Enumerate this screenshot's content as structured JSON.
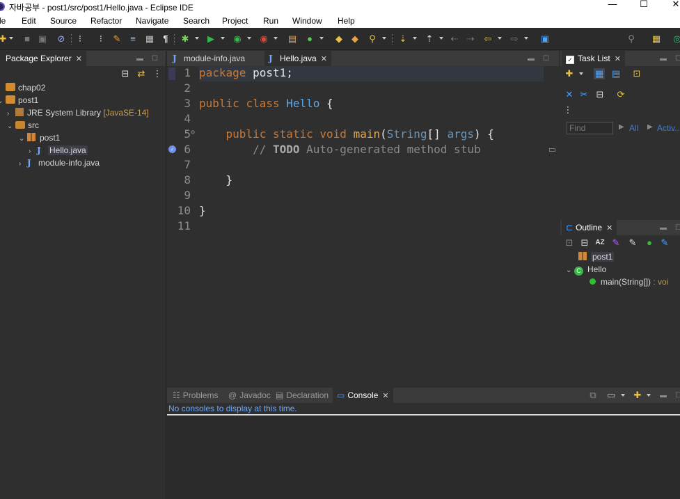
{
  "window": {
    "title": "자바공부 - post1/src/post1/Hello.java - Eclipse IDE",
    "minimize": "—",
    "maximize": "☐",
    "close": "✕"
  },
  "menu": [
    "le",
    "Edit",
    "Source",
    "Refactor",
    "Navigate",
    "Search",
    "Project",
    "Run",
    "Window",
    "Help"
  ],
  "package_explorer": {
    "tab_label": "Package Explorer",
    "tree": [
      {
        "label": "chap02",
        "kind": "project",
        "expanded": false
      },
      {
        "label": "post1",
        "kind": "project",
        "expanded": true
      },
      {
        "label": "JRE System Library",
        "decoration": "[JavaSE-14]",
        "kind": "library",
        "expanded": false
      },
      {
        "label": "src",
        "kind": "folder",
        "expanded": true
      },
      {
        "label": "post1",
        "kind": "package",
        "expanded": true
      },
      {
        "label": "Hello.java",
        "kind": "java-file",
        "selected": true
      },
      {
        "label": "module-info.java",
        "kind": "java-file"
      }
    ]
  },
  "editor": {
    "tabs": [
      {
        "label": "module-info.java",
        "active": false
      },
      {
        "label": "Hello.java",
        "active": true
      }
    ],
    "line_numbers": [
      "1",
      "2",
      "3",
      "4",
      "5",
      "6",
      "7",
      "8",
      "9",
      "10",
      "11"
    ],
    "lines": [
      {
        "parts": [
          [
            "kw",
            "package"
          ],
          [
            "txt",
            " post1;"
          ]
        ]
      },
      {
        "parts": []
      },
      {
        "parts": [
          [
            "kw",
            "public"
          ],
          [
            "txt",
            " "
          ],
          [
            "kw",
            "class"
          ],
          [
            "txt",
            " "
          ],
          [
            "cls",
            "Hello"
          ],
          [
            "txt",
            " {"
          ]
        ]
      },
      {
        "parts": []
      },
      {
        "parts": [
          [
            "txt",
            "    "
          ],
          [
            "kw",
            "public"
          ],
          [
            "txt",
            " "
          ],
          [
            "kw",
            "static"
          ],
          [
            "txt",
            " "
          ],
          [
            "kw",
            "void"
          ],
          [
            "txt",
            " "
          ],
          [
            "meth",
            "main"
          ],
          [
            "txt",
            "("
          ],
          [
            "typ",
            "String"
          ],
          [
            "txt",
            "[] "
          ],
          [
            "typ",
            "args"
          ],
          [
            "txt",
            ") {"
          ]
        ]
      },
      {
        "parts": [
          [
            "txt",
            "        "
          ],
          [
            "cmt",
            "// "
          ],
          [
            "todo",
            "TODO"
          ],
          [
            "cmt",
            " Auto-generated method stub"
          ]
        ]
      },
      {
        "parts": []
      },
      {
        "parts": [
          [
            "txt",
            "    }"
          ]
        ]
      },
      {
        "parts": []
      },
      {
        "parts": [
          [
            "txt",
            "}"
          ]
        ]
      },
      {
        "parts": []
      }
    ]
  },
  "task_list": {
    "tab_label": "Task List",
    "find_placeholder": "Find",
    "all_label": "All",
    "activate_label": "Activ..."
  },
  "outline": {
    "tab_label": "Outline",
    "items": [
      {
        "label": "post1",
        "kind": "package"
      },
      {
        "label": "Hello",
        "kind": "class"
      },
      {
        "label": "main(String[])",
        "suffix": ": voi",
        "kind": "method"
      }
    ]
  },
  "bottom": {
    "tabs": [
      {
        "label": "Problems",
        "active": false
      },
      {
        "label": "Javadoc",
        "active": false
      },
      {
        "label": "Declaration",
        "active": false
      },
      {
        "label": "Console",
        "active": true
      }
    ],
    "message": "No consoles to display at this time."
  },
  "colors": {
    "keyword": "#cc7832",
    "class_name": "#59a8e8",
    "method": "#e4a848",
    "comment": "#8a8a8a",
    "link": "#3f7ddb",
    "console_message": "#6aa8ff"
  }
}
